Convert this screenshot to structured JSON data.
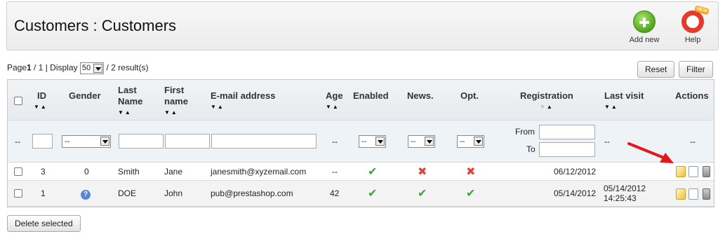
{
  "header": {
    "title": "Customers : Customers",
    "add_new_label": "Add new",
    "help_label": "Help",
    "help_badge": "NEW"
  },
  "pager": {
    "page_prefix": "Page",
    "page_current": "1",
    "page_rest": " / 1 | Display",
    "display_value": "50",
    "results_text": "/ 2 result(s)"
  },
  "buttons": {
    "reset": "Reset",
    "filter": "Filter",
    "delete_selected": "Delete selected"
  },
  "table": {
    "columns": {
      "id": "ID",
      "gender": "Gender",
      "last_name_1": "Last",
      "last_name_2": "Name",
      "first_name_1": "First",
      "first_name_2": "name",
      "email": "E-mail address",
      "age": "Age",
      "enabled": "Enabled",
      "news": "News.",
      "opt": "Opt.",
      "registration": "Registration",
      "last_visit": "Last visit",
      "actions": "Actions"
    },
    "filters": {
      "dash": "--",
      "gender_select": "--",
      "enabled_select": "--",
      "news_select": "--",
      "opt_select": "--",
      "from_label": "From",
      "to_label": "To"
    },
    "rows": [
      {
        "id": "3",
        "gender": "0",
        "last_name": "Smith",
        "first_name": "Jane",
        "email": "janesmith@xyzemail.com",
        "age": "--",
        "enabled": "check",
        "news": "cross",
        "opt": "cross",
        "registration": "06/12/2012",
        "last_visit_date": "",
        "last_visit_time": ""
      },
      {
        "id": "1",
        "gender": "?",
        "last_name": "DOE",
        "first_name": "John",
        "email": "pub@prestashop.com",
        "age": "42",
        "enabled": "check",
        "news": "check",
        "opt": "check",
        "registration": "05/14/2012",
        "last_visit_date": "05/14/2012",
        "last_visit_time": "14:25:43"
      }
    ]
  },
  "symbols": {
    "check": "✔",
    "cross": "✖"
  },
  "colors": {
    "check": "#3aa63a",
    "cross": "#e0453a",
    "annotation_arrow": "#e8161b"
  }
}
